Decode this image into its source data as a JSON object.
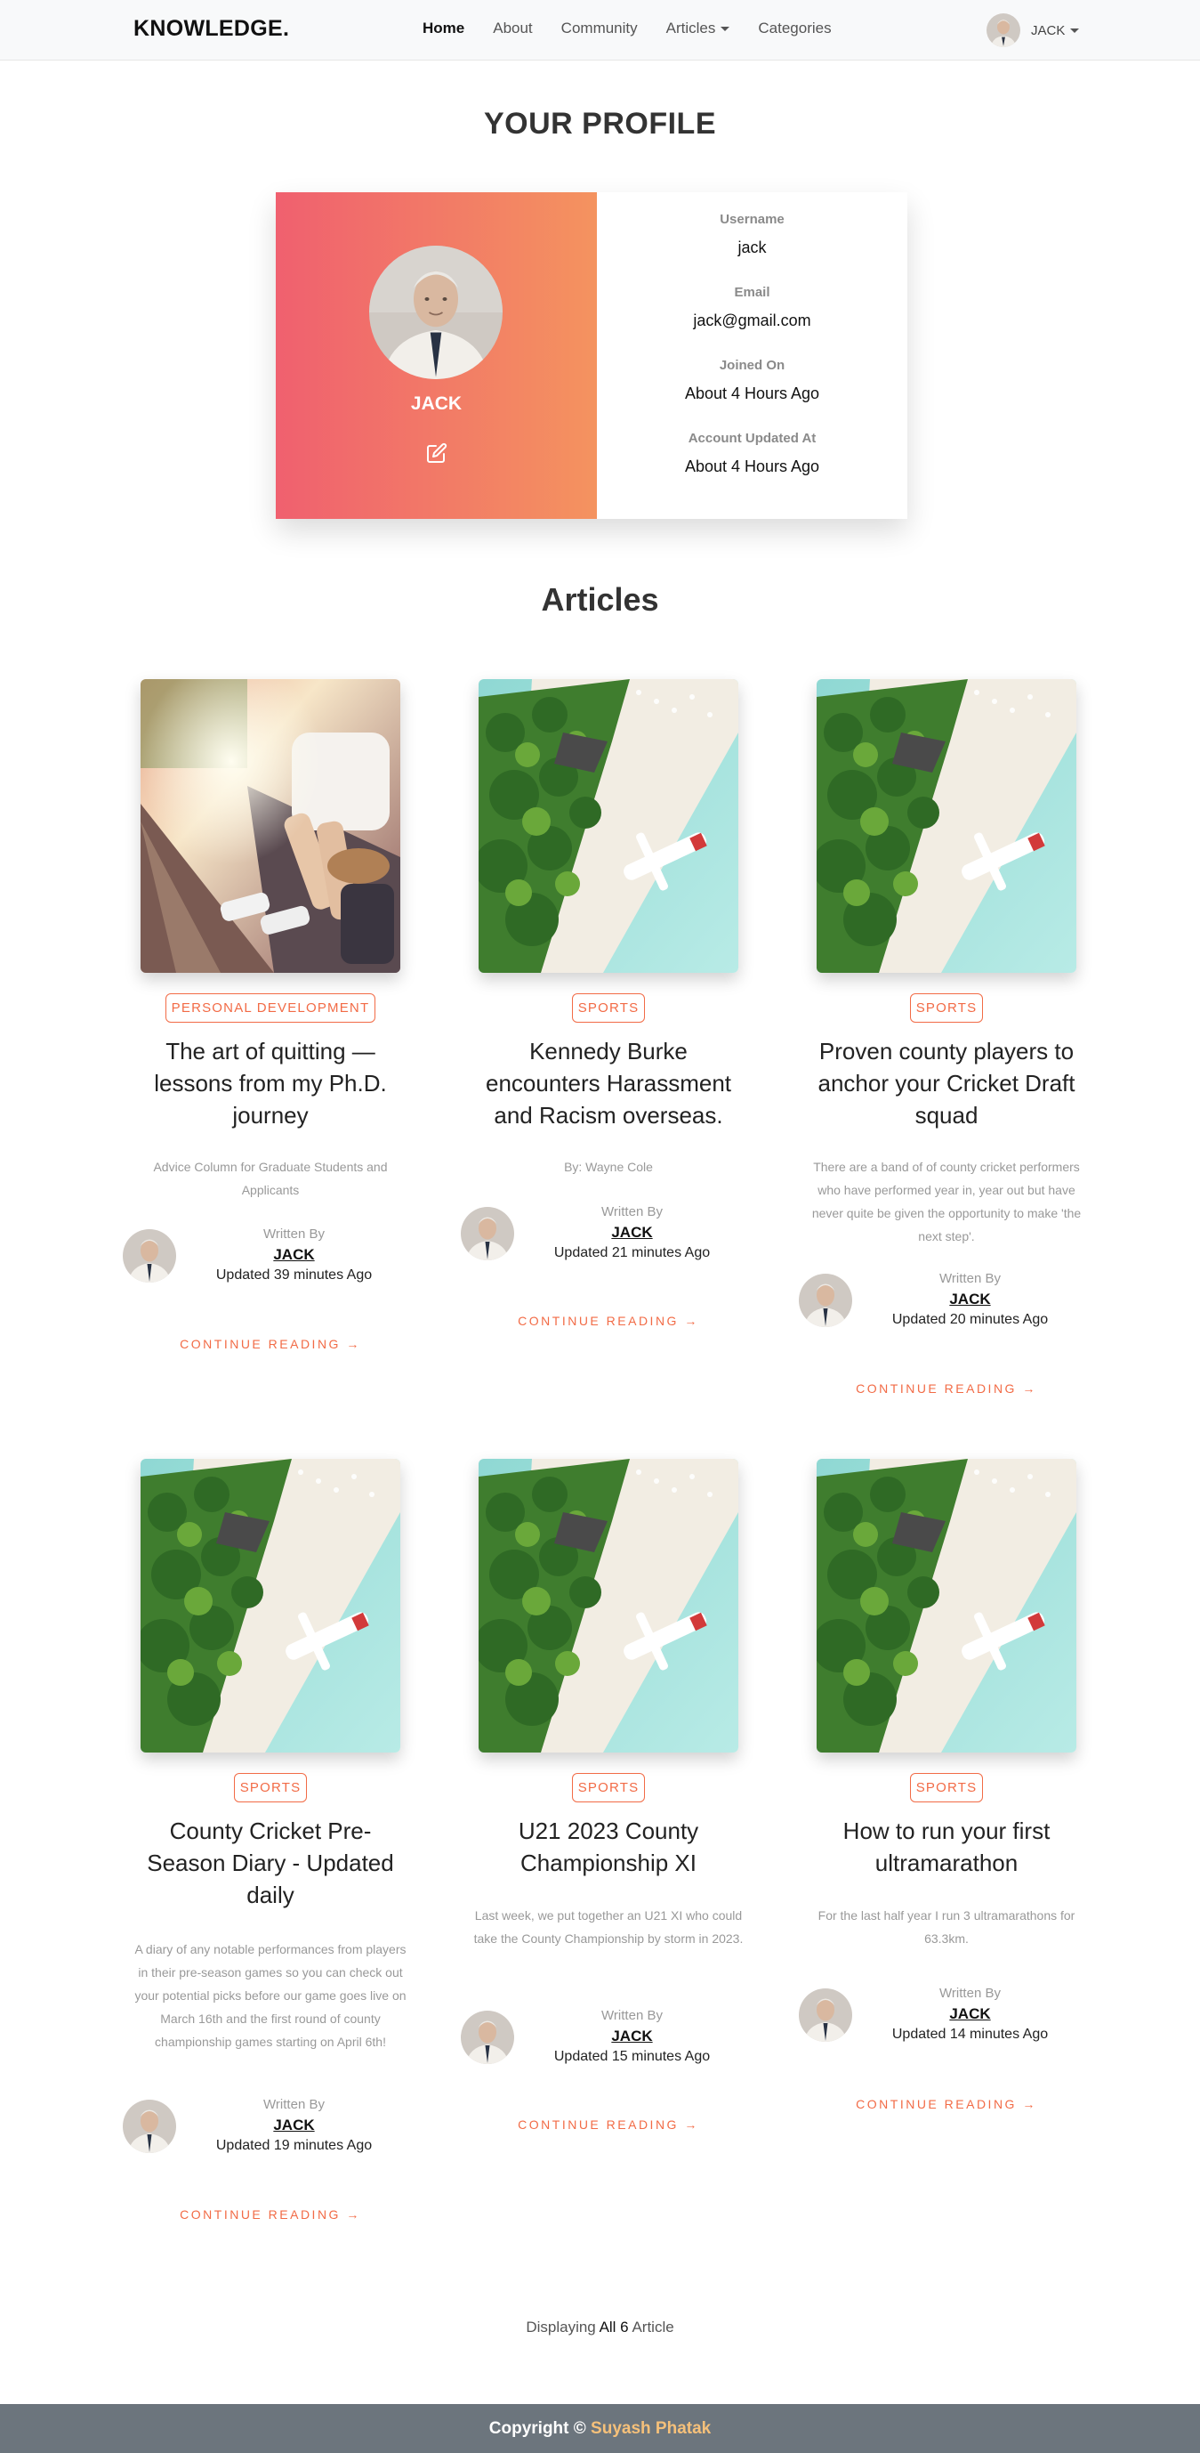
{
  "nav": {
    "brand": "KNOWLEDGE.",
    "links": [
      "Home",
      "About",
      "Community",
      "Articles",
      "Categories"
    ],
    "user": "JACK"
  },
  "profile": {
    "heading": "YOUR PROFILE",
    "name": "JACK",
    "fields": [
      {
        "label": "Username",
        "value": "jack"
      },
      {
        "label": "Email",
        "value": "jack@gmail.com"
      },
      {
        "label": "Joined On",
        "value": "About 4 Hours Ago"
      },
      {
        "label": "Account Updated At",
        "value": "About 4 Hours Ago"
      }
    ],
    "colors": {
      "gradient_start": "#f0606f",
      "gradient_end": "#f4935f"
    }
  },
  "articles": {
    "heading": "Articles",
    "written_by": "Written By",
    "continue": "CONTINUE READING",
    "items": [
      {
        "category": "PERSONAL DEVELOPMENT",
        "title": "The art of quitting — lessons from my Ph.D. journey",
        "desc": "Advice Column for Graduate Students and Applicants",
        "author": "JACK",
        "updated": "Updated 39 minutes Ago",
        "image": "railway"
      },
      {
        "category": "SPORTS",
        "title": "Kennedy Burke encounters Harassment and Racism overseas.",
        "desc": "By: Wayne Cole",
        "author": "JACK",
        "updated": "Updated 21 minutes Ago",
        "image": "beach"
      },
      {
        "category": "SPORTS",
        "title": "Proven county players to anchor your Cricket Draft squad",
        "desc": "There are a band of of county cricket performers who have performed year in, year out but have never quite be given the opportunity to make 'the next step'.",
        "author": "JACK",
        "updated": "Updated 20 minutes Ago",
        "image": "beach"
      },
      {
        "category": "SPORTS",
        "title": "County Cricket Pre-Season Diary - Updated daily",
        "desc": "A diary of any notable performances from players in their pre-season games so you can check out your potential picks before our game goes live on March 16th and the first round of county championship games starting on April 6th!",
        "author": "JACK",
        "updated": "Updated 19 minutes Ago",
        "image": "beach"
      },
      {
        "category": "SPORTS",
        "title": "U21 2023 County Championship XI",
        "desc": "Last week, we put together an U21 XI who could take the County Championship by storm in 2023.",
        "author": "JACK",
        "updated": "Updated 15 minutes Ago",
        "image": "beach"
      },
      {
        "category": "SPORTS",
        "title": "How to run your first ultramarathon",
        "desc": "For the last half year I run 3 ultramarathons for 63.3km.",
        "author": "JACK",
        "updated": "Updated 14 minutes Ago",
        "image": "beach"
      }
    ]
  },
  "summary": {
    "prefix": "Displaying",
    "count": "All 6",
    "suffix": "Article"
  },
  "footer": {
    "prefix": "Copyright ©",
    "name": "Suyash Phatak"
  }
}
